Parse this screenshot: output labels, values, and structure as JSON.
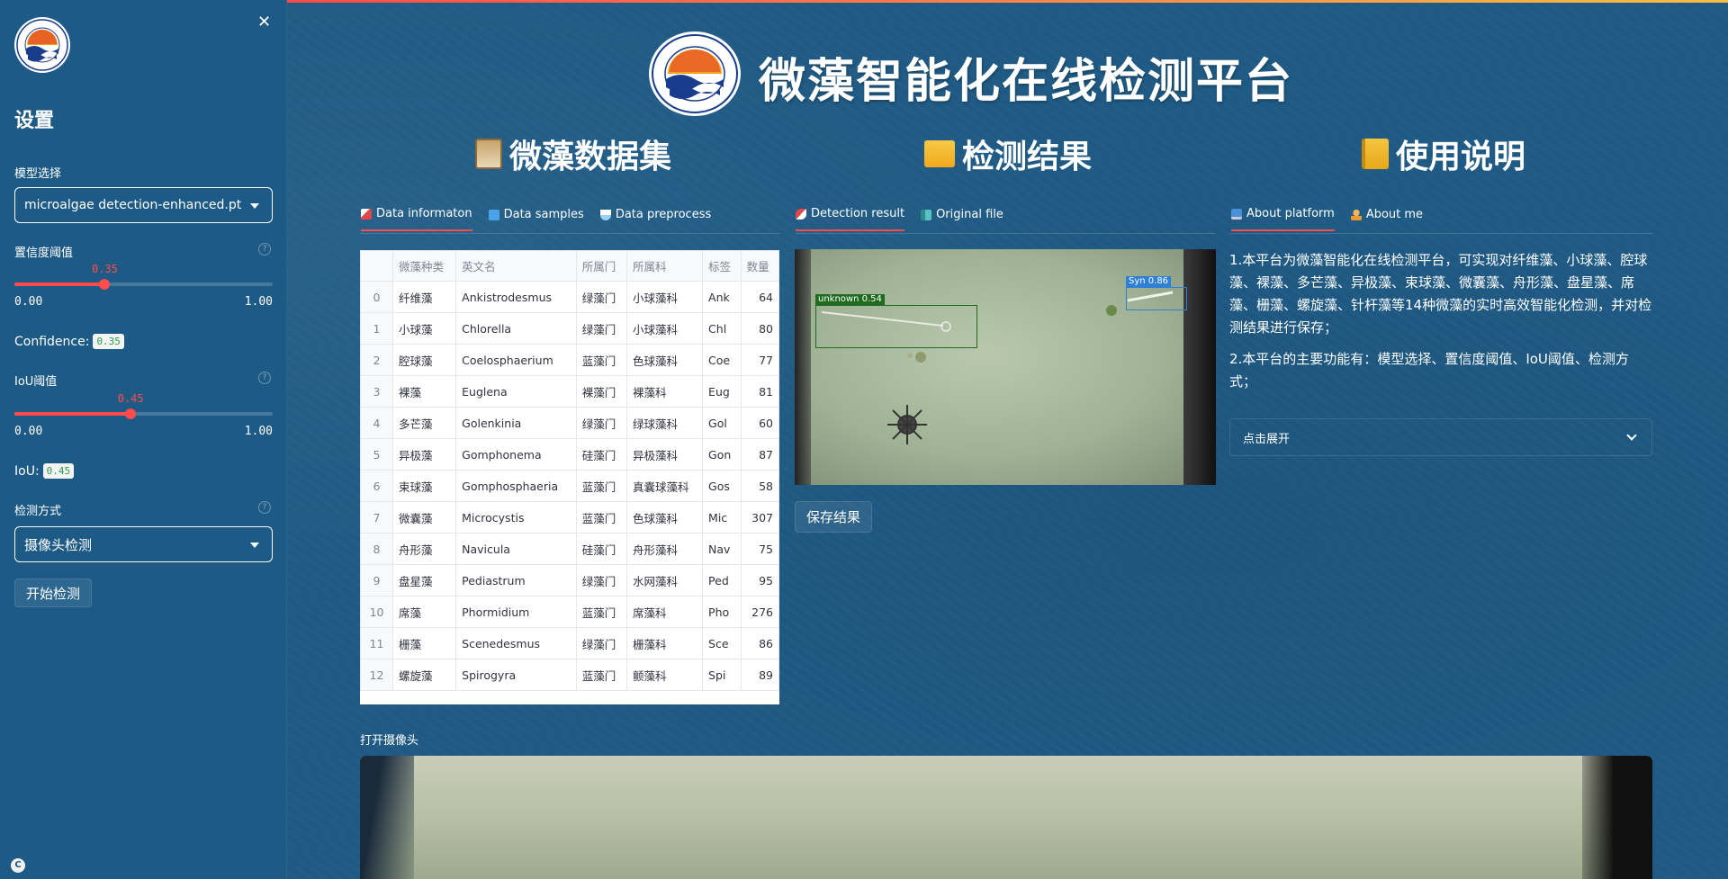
{
  "sidebar": {
    "close_icon": "close-icon",
    "title": "设置",
    "model": {
      "label": "模型选择",
      "value": "microalgae detection-enhanced.pt"
    },
    "confidence_slider": {
      "label": "置信度阈值",
      "value": 0.35,
      "value_text": "0.35",
      "min": "0.00",
      "max": "1.00"
    },
    "confidence_readout": {
      "label": "Confidence:",
      "value": "0.35"
    },
    "iou_slider": {
      "label": "IoU阈值",
      "value": 0.45,
      "value_text": "0.45",
      "min": "0.00",
      "max": "1.00"
    },
    "iou_readout": {
      "label": "IoU:",
      "value": "0.45"
    },
    "detect_mode": {
      "label": "检测方式",
      "value": "摄像头检测"
    },
    "start_button": "开始检测"
  },
  "header": {
    "title": "微藻智能化在线检测平台"
  },
  "columns": {
    "dataset": {
      "title": "微藻数据集",
      "tabs": [
        {
          "label": "Data informaton",
          "icon": "chart-icon",
          "active": true
        },
        {
          "label": "Data samples",
          "icon": "cube-icon",
          "active": false
        },
        {
          "label": "Data preprocess",
          "icon": "flask-icon",
          "active": false
        }
      ]
    },
    "results": {
      "title": "检测结果",
      "tabs": [
        {
          "label": "Detection result",
          "icon": "rocket-icon",
          "active": true
        },
        {
          "label": "Original file",
          "icon": "book-icon",
          "active": false
        }
      ],
      "save_button": "保存结果",
      "detections": [
        {
          "label": "unknown 0.54",
          "color": "#1f6b1f"
        },
        {
          "label": "Syn 0.86",
          "color": "#2f7fd6"
        }
      ]
    },
    "usage": {
      "title": "使用说明",
      "tabs": [
        {
          "label": "About platform",
          "icon": "computer-icon",
          "active": true
        },
        {
          "label": "About me",
          "icon": "person-icon",
          "active": false
        }
      ],
      "paragraphs": [
        "1.本平台为微藻智能化在线检测平台，可实现对纤维藻、小球藻、腔球藻、裸藻、多芒藻、异极藻、束球藻、微囊藻、舟形藻、盘星藻、席藻、栅藻、螺旋藻、针杆藻等14种微藻的实时高效智能化检测，并对检测结果进行保存；",
        "2.本平台的主要功能有：模型选择、置信度阈值、IoU阈值、检测方式；"
      ],
      "expander": "点击展开"
    }
  },
  "table": {
    "headers": [
      "",
      "微藻种类",
      "英文名",
      "所属门",
      "所属科",
      "标签",
      "数量"
    ],
    "rows": [
      [
        "0",
        "纤维藻",
        "Ankistrodesmus",
        "绿藻门",
        "小球藻科",
        "Ank",
        "64"
      ],
      [
        "1",
        "小球藻",
        "Chlorella",
        "绿藻门",
        "小球藻科",
        "Chl",
        "80"
      ],
      [
        "2",
        "腔球藻",
        "Coelosphaerium",
        "蓝藻门",
        "色球藻科",
        "Coe",
        "77"
      ],
      [
        "3",
        "裸藻",
        "Euglena",
        "裸藻门",
        "裸藻科",
        "Eug",
        "81"
      ],
      [
        "4",
        "多芒藻",
        "Golenkinia",
        "绿藻门",
        "绿球藻科",
        "Gol",
        "60"
      ],
      [
        "5",
        "异极藻",
        "Gomphonema",
        "硅藻门",
        "异极藻科",
        "Gon",
        "87"
      ],
      [
        "6",
        "束球藻",
        "Gomphosphaeria",
        "蓝藻门",
        "真囊球藻科",
        "Gos",
        "58"
      ],
      [
        "7",
        "微囊藻",
        "Microcystis",
        "蓝藻门",
        "色球藻科",
        "Mic",
        "307"
      ],
      [
        "8",
        "舟形藻",
        "Navicula",
        "硅藻门",
        "舟形藻科",
        "Nav",
        "75"
      ],
      [
        "9",
        "盘星藻",
        "Pediastrum",
        "绿藻门",
        "水网藻科",
        "Ped",
        "95"
      ],
      [
        "10",
        "席藻",
        "Phormidium",
        "蓝藻门",
        "席藻科",
        "Pho",
        "276"
      ],
      [
        "11",
        "栅藻",
        "Scenedesmus",
        "绿藻门",
        "栅藻科",
        "Sce",
        "86"
      ],
      [
        "12",
        "螺旋藻",
        "Spirogyra",
        "蓝藻门",
        "颤藻科",
        "Spi",
        "89"
      ]
    ]
  },
  "camera": {
    "label": "打开摄像头"
  },
  "footer": {
    "badge": "C"
  }
}
